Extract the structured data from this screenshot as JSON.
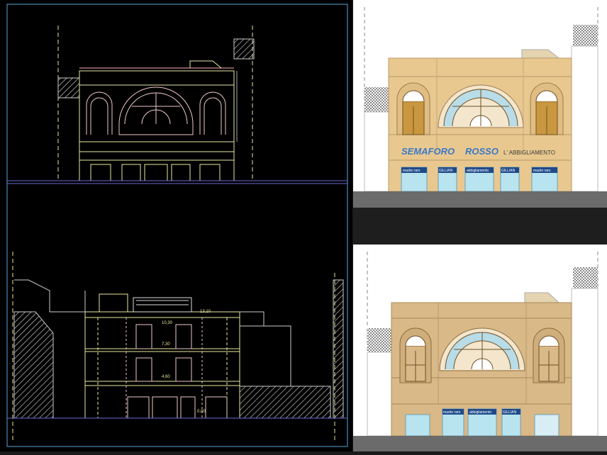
{
  "cad": {
    "section_levels": [
      "13,10",
      "10,30",
      "7,30",
      "4,60",
      "0,00"
    ]
  },
  "elevation_colored": {
    "sign_main_word1": "SEMAFORO",
    "sign_main_word2": "ROSSO",
    "sign_secondary": "L' ABBIGLIAMENTO",
    "shop_signs": [
      "madre raro",
      "GILLIAN",
      "abbigliamento",
      "GILLIAN",
      "madre raro"
    ]
  },
  "elevation_plain": {
    "shop_signs": [
      "madre raro",
      "abbigliamento",
      "GILLIAN"
    ]
  },
  "colors": {
    "cad_background": "#000000",
    "cad_frame": "#5aa6d8",
    "cad_lines_yellow": "#e8e8a0",
    "cad_lines_pink": "#f0c8c8",
    "facade_top": "#e8c88f",
    "facade_bottom": "#d9b987",
    "glass": "#b8e4f0",
    "sign_blue": "#3a78c8",
    "ground": "#6b6b6b"
  }
}
